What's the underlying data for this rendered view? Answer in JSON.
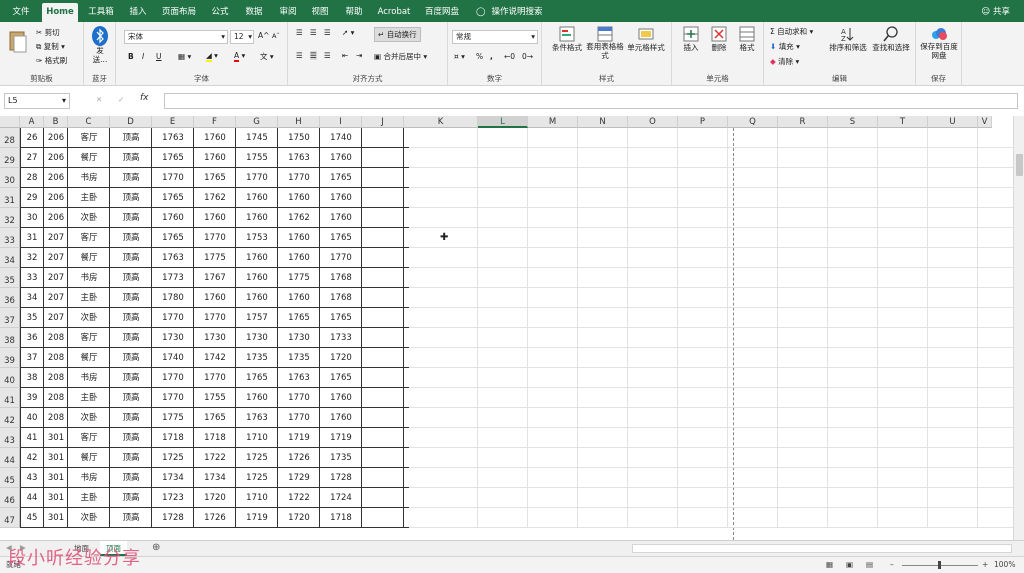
{
  "ribbon_tabs": [
    "文件",
    "Home",
    "工具箱",
    "插入",
    "页面布局",
    "公式",
    "数据",
    "审阅",
    "视图",
    "帮助",
    "Acrobat",
    "百度网盘"
  ],
  "search_label": "操作说明搜索",
  "share_label": "共享",
  "clipboard": {
    "cut": "剪切",
    "copy": "复制",
    "format_painter": "格式刷",
    "label": "剪贴板"
  },
  "bluetooth": {
    "send": "发送...",
    "label": "蓝牙"
  },
  "font": {
    "name": "宋体",
    "size": "12",
    "label": "字体",
    "bold": "B",
    "italic": "I",
    "underline": "U",
    "grow": "A",
    "shrink": "A",
    "color": "A"
  },
  "alignment": {
    "wrap": "自动换行",
    "merge": "合并后居中",
    "label": "对齐方式"
  },
  "number": {
    "format": "常规",
    "percent": "%",
    "comma": ",",
    "label": "数字"
  },
  "styles": {
    "conditional": "条件格式",
    "table": "套用表格格式",
    "cell_styles": "单元格样式",
    "label": "样式"
  },
  "cells": {
    "insert": "插入",
    "delete": "删除",
    "format": "格式",
    "label": "单元格"
  },
  "editing": {
    "autosum": "自动求和",
    "fill": "填充",
    "clear": "清除",
    "sort": "排序和筛选",
    "find": "查找和选择",
    "label": "编辑"
  },
  "save": {
    "button": "保存到百度网盘",
    "label": "保存"
  },
  "name_box": "L5",
  "fx_symbol": "fx",
  "columns": [
    "A",
    "B",
    "C",
    "D",
    "E",
    "F",
    "G",
    "H",
    "I",
    "J",
    "K",
    "L",
    "M",
    "N",
    "O",
    "P",
    "Q",
    "R",
    "S",
    "T",
    "U",
    "V"
  ],
  "selected_column": "L",
  "row_numbers": [
    "28",
    "29",
    "30",
    "31",
    "32",
    "33",
    "34",
    "35",
    "36",
    "37",
    "38",
    "39",
    "40",
    "41",
    "42",
    "43",
    "44",
    "45",
    "46",
    "47"
  ],
  "rows": [
    [
      "26",
      "206",
      "客厅",
      "顶高",
      "1763",
      "1760",
      "1745",
      "1750",
      "1740"
    ],
    [
      "27",
      "206",
      "餐厅",
      "顶高",
      "1765",
      "1760",
      "1755",
      "1763",
      "1760"
    ],
    [
      "28",
      "206",
      "书房",
      "顶高",
      "1770",
      "1765",
      "1770",
      "1770",
      "1765"
    ],
    [
      "29",
      "206",
      "主卧",
      "顶高",
      "1765",
      "1762",
      "1760",
      "1760",
      "1760"
    ],
    [
      "30",
      "206",
      "次卧",
      "顶高",
      "1760",
      "1760",
      "1760",
      "1762",
      "1760"
    ],
    [
      "31",
      "207",
      "客厅",
      "顶高",
      "1765",
      "1770",
      "1753",
      "1760",
      "1765"
    ],
    [
      "32",
      "207",
      "餐厅",
      "顶高",
      "1763",
      "1775",
      "1760",
      "1760",
      "1770"
    ],
    [
      "33",
      "207",
      "书房",
      "顶高",
      "1773",
      "1767",
      "1760",
      "1775",
      "1768"
    ],
    [
      "34",
      "207",
      "主卧",
      "顶高",
      "1780",
      "1760",
      "1760",
      "1760",
      "1768"
    ],
    [
      "35",
      "207",
      "次卧",
      "顶高",
      "1770",
      "1770",
      "1757",
      "1765",
      "1765"
    ],
    [
      "36",
      "208",
      "客厅",
      "顶高",
      "1730",
      "1730",
      "1730",
      "1730",
      "1733"
    ],
    [
      "37",
      "208",
      "餐厅",
      "顶高",
      "1740",
      "1742",
      "1735",
      "1735",
      "1720"
    ],
    [
      "38",
      "208",
      "书房",
      "顶高",
      "1770",
      "1770",
      "1765",
      "1763",
      "1765"
    ],
    [
      "39",
      "208",
      "主卧",
      "顶高",
      "1770",
      "1755",
      "1760",
      "1770",
      "1760"
    ],
    [
      "40",
      "208",
      "次卧",
      "顶高",
      "1775",
      "1765",
      "1763",
      "1770",
      "1760"
    ],
    [
      "41",
      "301",
      "客厅",
      "顶高",
      "1718",
      "1718",
      "1710",
      "1719",
      "1719"
    ],
    [
      "42",
      "301",
      "餐厅",
      "顶高",
      "1725",
      "1722",
      "1725",
      "1726",
      "1735"
    ],
    [
      "43",
      "301",
      "书房",
      "顶高",
      "1734",
      "1734",
      "1725",
      "1729",
      "1728"
    ],
    [
      "44",
      "301",
      "主卧",
      "顶高",
      "1723",
      "1720",
      "1710",
      "1722",
      "1724"
    ],
    [
      "45",
      "301",
      "次卧",
      "顶高",
      "1728",
      "1726",
      "1719",
      "1720",
      "1718"
    ]
  ],
  "sheet_tabs": [
    "地面",
    "顶面"
  ],
  "active_sheet": "顶面",
  "status_text": "就绪",
  "zoom": "100%",
  "watermark": "段小听经验分享",
  "colors": {
    "excel_green": "#217346",
    "watermark": "#e0547a"
  }
}
